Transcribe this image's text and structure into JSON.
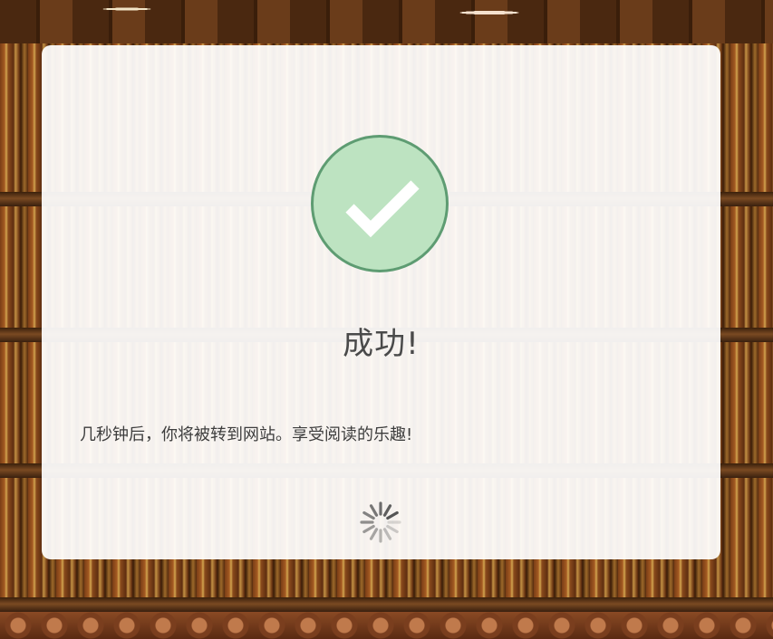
{
  "dialog": {
    "title": "成功!",
    "message": "几秒钟后，你将被转到网站。享受阅读的乐趣!",
    "status_icon": "checkmark-circle-icon",
    "loading_icon": "spinner-icon"
  },
  "colors": {
    "icon_fill": "#bde3c1",
    "icon_border": "#5e9c72",
    "check": "#ffffff",
    "text": "#4a4a4a",
    "spinner": "#555555"
  }
}
